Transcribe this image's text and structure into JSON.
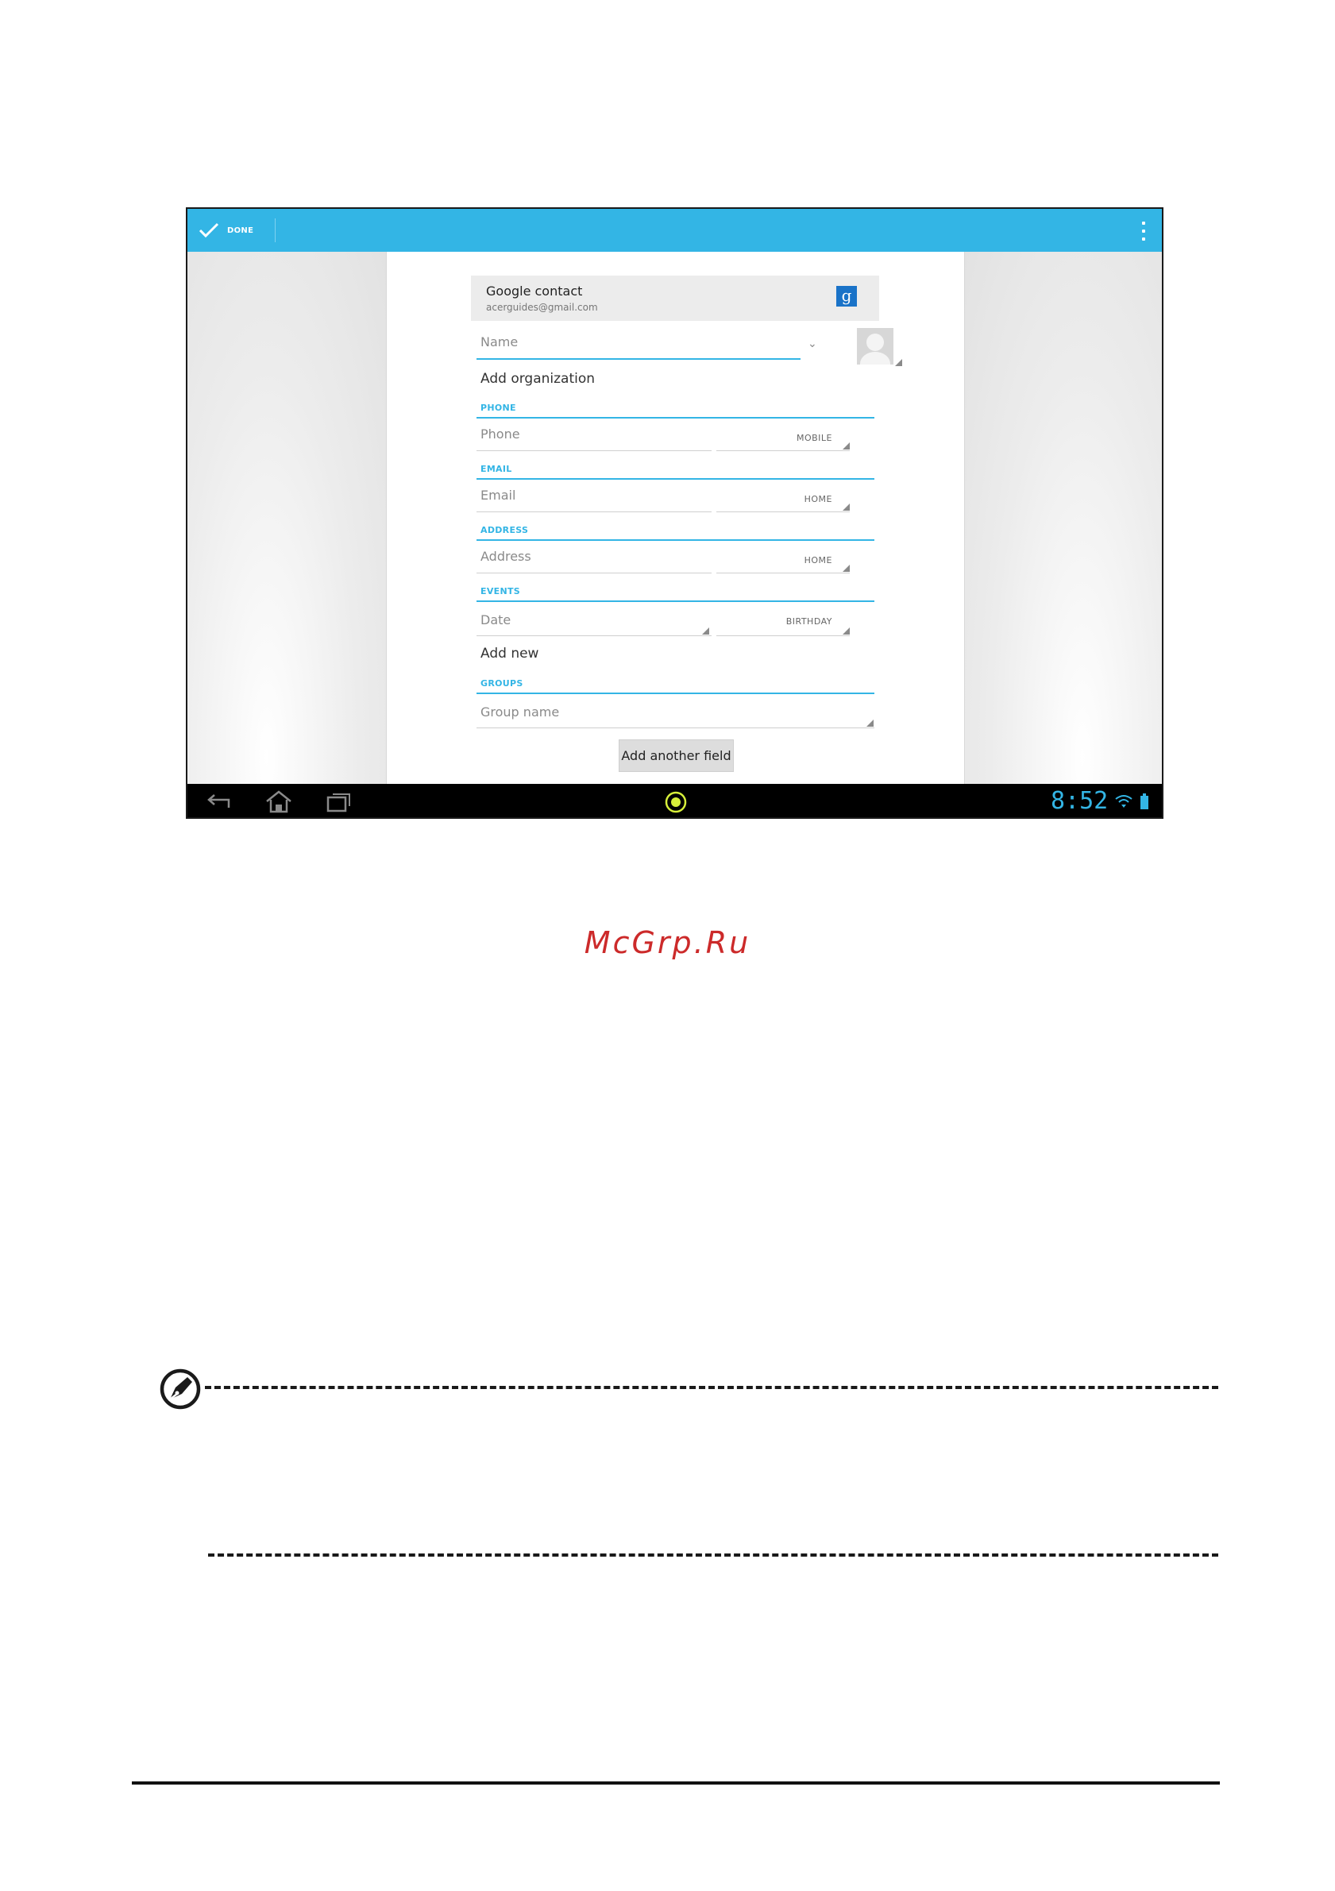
{
  "action_bar": {
    "done_label": "DONE",
    "color": "#33b5e5"
  },
  "account": {
    "title": "Google contact",
    "email": "acerguides@gmail.com",
    "icon_letter": "g"
  },
  "form": {
    "name_placeholder": "Name",
    "add_organization": "Add organization",
    "sections": {
      "phone": {
        "title": "PHONE",
        "placeholder": "Phone",
        "type": "MOBILE"
      },
      "email": {
        "title": "EMAIL",
        "placeholder": "Email",
        "type": "HOME"
      },
      "address": {
        "title": "ADDRESS",
        "placeholder": "Address",
        "type": "HOME"
      },
      "events": {
        "title": "EVENTS",
        "placeholder": "Date",
        "type": "BIRTHDAY",
        "add_new": "Add new"
      },
      "groups": {
        "title": "GROUPS",
        "placeholder": "Group name"
      }
    },
    "add_another_field": "Add another field"
  },
  "nav_bar": {
    "clock": "8:52"
  },
  "page": {
    "watermark": "McGrp.Ru"
  },
  "colors": {
    "accent": "#33b5e5",
    "watermark": "#cc2a2a",
    "center_button": "#d7ef3a"
  }
}
